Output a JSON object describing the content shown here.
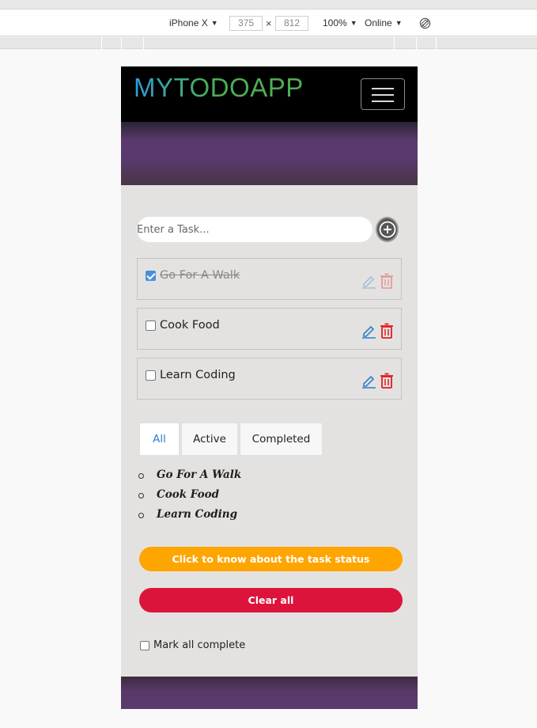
{
  "devtools": {
    "device": "iPhone X",
    "width": "375",
    "height": "812",
    "dim_separator": "×",
    "zoom": "100%",
    "network": "Online"
  },
  "app": {
    "brand": "MYTODOAPP",
    "input": {
      "placeholder": "Enter a Task...",
      "value": ""
    },
    "tasks": [
      {
        "label": "Go For A Walk",
        "completed": true
      },
      {
        "label": "Cook Food",
        "completed": false
      },
      {
        "label": "Learn Coding",
        "completed": false
      }
    ],
    "filter_tabs": [
      {
        "label": "All",
        "active": true
      },
      {
        "label": "Active",
        "active": false
      },
      {
        "label": "Completed",
        "active": false
      }
    ],
    "task_list": [
      "Go For A Walk",
      "Cook Food",
      "Learn Coding"
    ],
    "status_button": "Click to know about the task status",
    "clear_button": "Clear all",
    "mark_all_label": "Mark all complete"
  },
  "colors": {
    "brand_gradient_start": "#2d9dd8",
    "brand_gradient_end": "#4cae53",
    "status_button": "#ffa500",
    "clear_button": "#dc143c",
    "active_tab": "#2f80c8",
    "edit_icon": "#2f80c8",
    "delete_icon": "#e11d1d"
  }
}
